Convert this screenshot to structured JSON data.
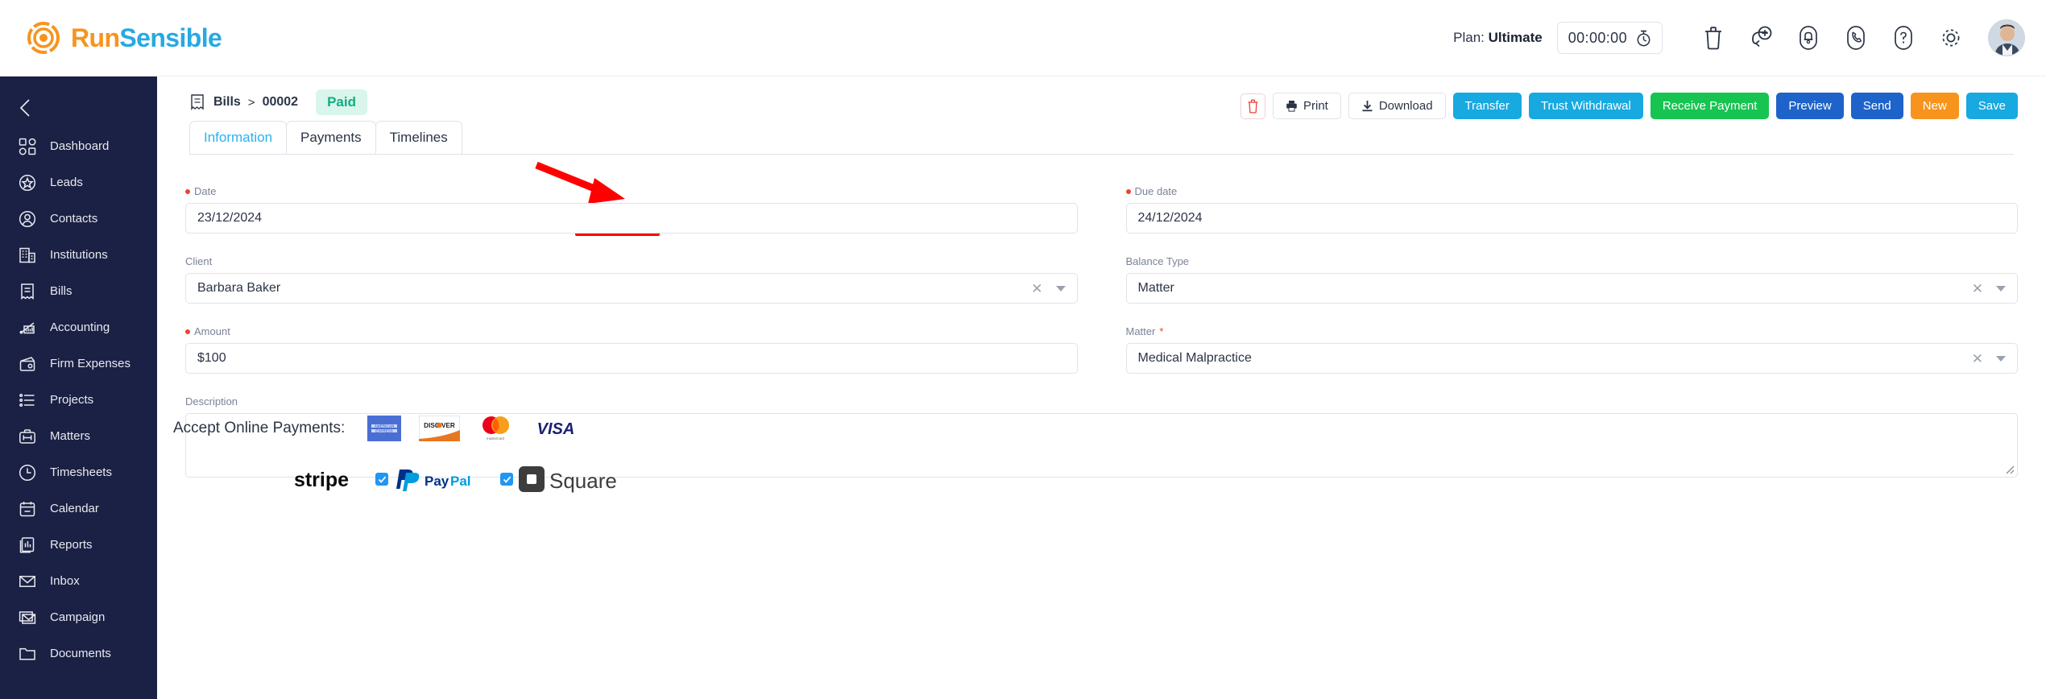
{
  "app": {
    "logo_run": "Run",
    "logo_sensible": "Sensible",
    "logo_icon": "runsensible-sun-logo"
  },
  "header": {
    "plan_prefix": "Plan:",
    "plan_value": "Ultimate",
    "timer_value": "00:00:00",
    "icons": [
      {
        "name": "stopwatch-icon"
      },
      {
        "name": "trash-icon"
      },
      {
        "name": "add-circle-icon"
      },
      {
        "name": "bell-icon"
      },
      {
        "name": "phone-icon"
      },
      {
        "name": "help-icon"
      },
      {
        "name": "gear-icon"
      },
      {
        "name": "avatar"
      }
    ]
  },
  "sidebar": {
    "collapse_icon": "chevron-left-icon",
    "items": [
      {
        "label": "Dashboard",
        "icon": "dashboard-icon"
      },
      {
        "label": "Leads",
        "icon": "star-circle-icon"
      },
      {
        "label": "Contacts",
        "icon": "user-circle-icon"
      },
      {
        "label": "Institutions",
        "icon": "building-icon"
      },
      {
        "label": "Bills",
        "icon": "receipt-icon"
      },
      {
        "label": "Accounting",
        "icon": "chart-bar-icon"
      },
      {
        "label": "Firm Expenses",
        "icon": "wallet-icon"
      },
      {
        "label": "Projects",
        "icon": "list-icon"
      },
      {
        "label": "Matters",
        "icon": "briefcase-icon"
      },
      {
        "label": "Timesheets",
        "icon": "clock-icon"
      },
      {
        "label": "Calendar",
        "icon": "calendar-icon"
      },
      {
        "label": "Reports",
        "icon": "report-icon"
      },
      {
        "label": "Inbox",
        "icon": "envelope-icon"
      },
      {
        "label": "Campaign",
        "icon": "campaign-envelope-icon"
      },
      {
        "label": "Documents",
        "icon": "folder-icon"
      }
    ]
  },
  "breadcrumb": {
    "icon": "receipt-icon",
    "root": "Bills",
    "separator": ">",
    "current": "00002",
    "status_badge": "Paid",
    "status_color": "#0fae7f"
  },
  "tabs": [
    {
      "label": "Information",
      "active": true
    },
    {
      "label": "Payments",
      "active": false
    },
    {
      "label": "Timelines",
      "active": false,
      "highlighted": true
    }
  ],
  "annotation": {
    "color": "#ff0000",
    "arrow": "red-arrow-pointing-to-timelines-tab",
    "box_target": "Timelines"
  },
  "actions": [
    {
      "label": "",
      "name": "delete-button",
      "style": "trash",
      "icon": "trash-icon"
    },
    {
      "label": "Print",
      "name": "print-button",
      "style": "white",
      "icon": "printer-icon"
    },
    {
      "label": "Download",
      "name": "download-button",
      "style": "white",
      "icon": "download-icon"
    },
    {
      "label": "Transfer",
      "name": "transfer-button",
      "style": "cyan"
    },
    {
      "label": "Trust Withdrawal",
      "name": "trust-withdrawal-button",
      "style": "cyan"
    },
    {
      "label": "Receive Payment",
      "name": "receive-payment-button",
      "style": "green"
    },
    {
      "label": "Preview",
      "name": "preview-button",
      "style": "blue"
    },
    {
      "label": "Send",
      "name": "send-button",
      "style": "blue"
    },
    {
      "label": "New",
      "name": "new-button",
      "style": "orange"
    },
    {
      "label": "Save",
      "name": "save-button",
      "style": "cyan"
    }
  ],
  "form": {
    "date": {
      "label": "Date",
      "required": true,
      "value": "23/12/2024"
    },
    "due_date": {
      "label": "Due date",
      "required": true,
      "value": "24/12/2024"
    },
    "client": {
      "label": "Client",
      "required": false,
      "value": "Barbara Baker",
      "clearable": true
    },
    "balance_type": {
      "label": "Balance Type",
      "required": false,
      "value": "Matter",
      "clearable": true
    },
    "amount": {
      "label": "Amount",
      "required": true,
      "value": "$100"
    },
    "matter": {
      "label": "Matter",
      "asterisk": "*",
      "value": "Medical Malpractice",
      "clearable": true
    },
    "description": {
      "label": "Description",
      "value": ""
    }
  },
  "payments": {
    "title": "Accept Online Payments:",
    "cards": [
      "american-express-logo",
      "discover-logo",
      "mastercard-logo",
      "visa-logo"
    ],
    "processors": [
      {
        "name": "stripe",
        "label": "stripe",
        "checkbox": false
      },
      {
        "name": "paypal",
        "label": "PayPal",
        "checkbox": true,
        "checked": true
      },
      {
        "name": "square",
        "label": "Square",
        "checkbox": true,
        "checked": true
      }
    ]
  },
  "colors": {
    "sidebar_bg": "#1b2144",
    "brand_orange": "#F7941E",
    "brand_blue": "#27A9E1",
    "accent_cyan": "#17a9e0",
    "accent_green": "#17c452",
    "accent_blue": "#1d63c9",
    "accent_orange": "#f7941d",
    "required_red": "#ef4231"
  }
}
